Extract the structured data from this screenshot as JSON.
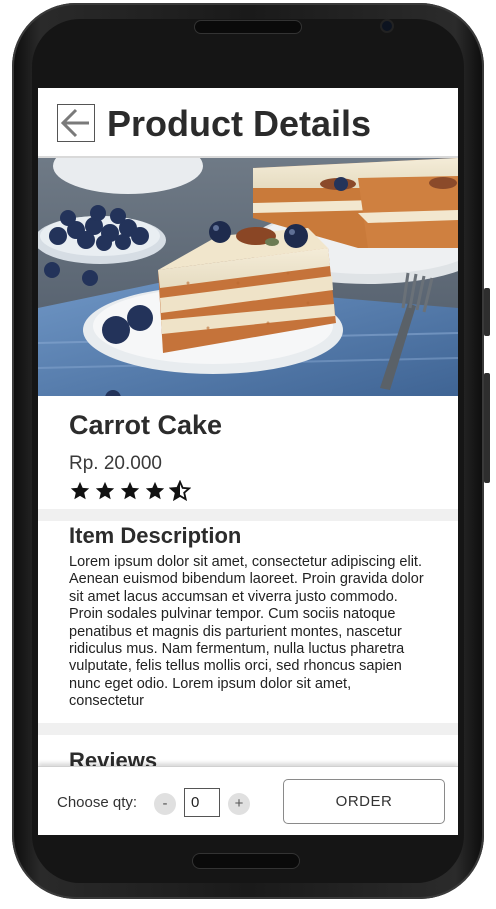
{
  "header": {
    "title": "Product Details",
    "back_icon": "arrow-left-icon"
  },
  "product": {
    "name": "Carrot Cake",
    "price": "Rp. 20.000",
    "rating": 4.5,
    "rating_max": 5
  },
  "description": {
    "title": "Item Description",
    "body": "Lorem ipsum dolor sit amet, consectetur adipiscing elit. Aenean euismod bibendum laoreet. Proin gravida dolor sit amet lacus accumsan et viverra justo commodo. Proin sodales pulvinar tempor. Cum sociis natoque penatibus et magnis dis parturient montes, nascetur ridiculus mus. Nam fermentum, nulla luctus pharetra vulputate, felis tellus mollis orci, sed rhoncus sapien nunc eget odio. Lorem ipsum dolor sit amet, consectetur"
  },
  "reviews": {
    "title": "Reviews"
  },
  "footer": {
    "qty_label": "Choose qty:",
    "minus_label": "-",
    "plus_label": "+",
    "qty_value": "0",
    "order_label": "ORDER"
  }
}
